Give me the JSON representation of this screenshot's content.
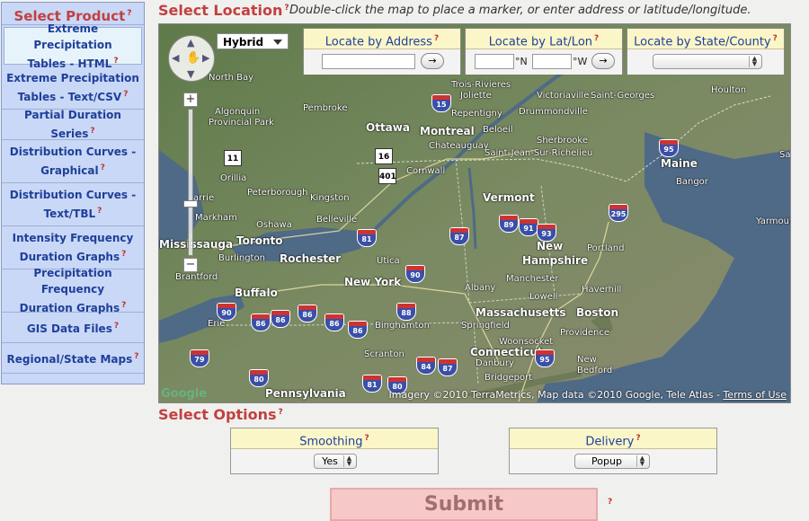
{
  "sidebar": {
    "title": "Select Product",
    "help": "?",
    "items": [
      {
        "label": "Extreme Precipitation Tables - HTML",
        "lines": [
          "Extreme Precipitation",
          "Tables - HTML"
        ]
      },
      {
        "label": "Extreme Precipitation Tables - Text/CSV",
        "lines": [
          "Extreme Precipitation",
          "Tables - Text/CSV"
        ]
      },
      {
        "label": "Partial Duration Series",
        "lines": [
          "Partial Duration Series"
        ]
      },
      {
        "label": "Distribution Curves - Graphical",
        "lines": [
          "Distribution Curves -",
          "Graphical"
        ]
      },
      {
        "label": "Distribution Curves - Text/TBL",
        "lines": [
          "Distribution Curves -",
          "Text/TBL"
        ]
      },
      {
        "label": "Intensity Frequency Duration Graphs",
        "lines": [
          "Intensity Frequency",
          "Duration Graphs"
        ]
      },
      {
        "label": "Precipitation Frequency Duration Graphs",
        "lines": [
          "Precipitation Frequency",
          "Duration Graphs"
        ]
      },
      {
        "label": "GIS Data Files",
        "lines": [
          "GIS Data Files"
        ]
      },
      {
        "label": "Regional/State Maps",
        "lines": [
          "Regional/State Maps"
        ]
      }
    ]
  },
  "location": {
    "title": "Select Location",
    "help": "?",
    "hint": "Double-click the map to place a marker, or enter address or latitude/longitude."
  },
  "map": {
    "type_label": "Hybrid",
    "zoom_in": "+",
    "zoom_out": "−",
    "locate_address": {
      "title": "Locate by Address",
      "help": "?",
      "value": "",
      "go": "→"
    },
    "locate_latlon": {
      "title": "Locate by Lat/Lon",
      "help": "?",
      "lat_unit": "°N",
      "lon_unit": "°W",
      "go": "→"
    },
    "locate_state": {
      "title": "Locate by State/County",
      "help": "?",
      "selected": ""
    },
    "attribution": "Imagery ©2010 TerraMetrics, Map data ©2010 Google, Tele Atlas - ",
    "terms": "Terms of Use",
    "logo": "Google",
    "labels": [
      {
        "t": "North Bay",
        "big": false
      },
      {
        "t": "Algonquin",
        "big": false
      },
      {
        "t": "Provincial Park",
        "big": false
      },
      {
        "t": "Pembroke",
        "big": false
      },
      {
        "t": "Ottawa",
        "big": true
      },
      {
        "t": "Montreal",
        "big": true
      },
      {
        "t": "Trois-Rivieres",
        "big": false
      },
      {
        "t": "Joliette",
        "big": false
      },
      {
        "t": "Victoriaville",
        "big": false
      },
      {
        "t": "Saint-Georges",
        "big": false
      },
      {
        "t": "Repentigny",
        "big": false
      },
      {
        "t": "Drummondville",
        "big": false
      },
      {
        "t": "Beloeil",
        "big": false
      },
      {
        "t": "Chateauguay",
        "big": false
      },
      {
        "t": "Sherbrooke",
        "big": false
      },
      {
        "t": "Saint-Jean-Sur-Richelieu",
        "big": false
      },
      {
        "t": "Houlton",
        "big": false
      },
      {
        "t": "Cornwall",
        "big": false
      },
      {
        "t": "Maine",
        "big": true
      },
      {
        "t": "Bangor",
        "big": false
      },
      {
        "t": "Saint Jo",
        "big": false
      },
      {
        "t": "Orillia",
        "big": false
      },
      {
        "t": "Peterborough",
        "big": false
      },
      {
        "t": "Kingston",
        "big": false
      },
      {
        "t": "arrie",
        "big": false
      },
      {
        "t": "Markham",
        "big": false
      },
      {
        "t": "Oshawa",
        "big": false
      },
      {
        "t": "Belleville",
        "big": false
      },
      {
        "t": "Vermont",
        "big": true
      },
      {
        "t": "Yarmouth",
        "big": false
      },
      {
        "t": "Toronto",
        "big": true
      },
      {
        "t": "Mississauga",
        "big": true
      },
      {
        "t": "Burlington",
        "big": false
      },
      {
        "t": "Rochester",
        "big": true
      },
      {
        "t": "Utica",
        "big": false
      },
      {
        "t": "New",
        "big": true
      },
      {
        "t": "Hampshire",
        "big": true
      },
      {
        "t": "Portland",
        "big": false
      },
      {
        "t": "Brantford",
        "big": false
      },
      {
        "t": "Buffalo",
        "big": true
      },
      {
        "t": "New York",
        "big": true
      },
      {
        "t": "Albany",
        "big": false
      },
      {
        "t": "Manchester",
        "big": false
      },
      {
        "t": "Haverhill",
        "big": false
      },
      {
        "t": "Lowell",
        "big": false
      },
      {
        "t": "Erie",
        "big": false
      },
      {
        "t": "Binghamton",
        "big": false
      },
      {
        "t": "Massachusetts",
        "big": true
      },
      {
        "t": "Boston",
        "big": true
      },
      {
        "t": "Springfield",
        "big": false
      },
      {
        "t": "Woonsocket",
        "big": false
      },
      {
        "t": "Providence",
        "big": false
      },
      {
        "t": "Connecticut",
        "big": true
      },
      {
        "t": "Scranton",
        "big": false
      },
      {
        "t": "Danbury",
        "big": false
      },
      {
        "t": "Bridgeport",
        "big": false
      },
      {
        "t": "New",
        "big": false
      },
      {
        "t": "Bedford",
        "big": false
      },
      {
        "t": "Pennsylvania",
        "big": true
      }
    ],
    "shields": [
      "15",
      "95",
      "81",
      "87",
      "89",
      "91",
      "93",
      "295",
      "90",
      "88",
      "90",
      "86",
      "86",
      "86",
      "86",
      "86",
      "79",
      "80",
      "81",
      "80",
      "84",
      "87",
      "95"
    ],
    "ca_shields": [
      "11",
      "16",
      "401"
    ]
  },
  "options": {
    "title": "Select Options",
    "help": "?",
    "smoothing": {
      "label": "Smoothing",
      "help": "?",
      "value": "Yes"
    },
    "delivery": {
      "label": "Delivery",
      "help": "?",
      "value": "Popup"
    }
  },
  "submit": {
    "label": "Submit",
    "help": "?"
  }
}
